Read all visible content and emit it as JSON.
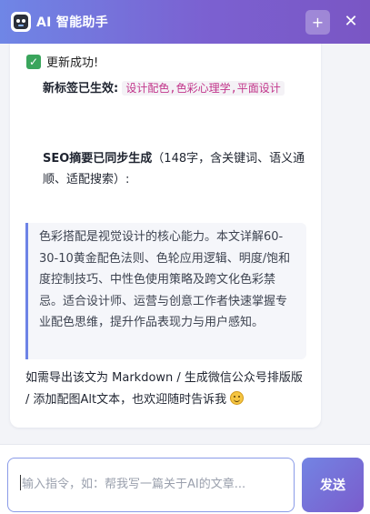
{
  "header": {
    "title": "AI 智能助手",
    "logo_icon": "robot-icon",
    "new_chat_label": "+",
    "close_label": "✕"
  },
  "message": {
    "success_icon": "check-icon",
    "success_text": "更新成功!",
    "tags_label": "新标签已生效:",
    "tags_value": "设计配色,色彩心理学,平面设计",
    "seo_label": "SEO摘要已同步生成",
    "seo_note": "（148字，含关键词、语义通顺、适配搜索）:",
    "seo_summary": "色彩搭配是视觉设计的核心能力。本文详解60-30-10黄金配色法则、色轮应用逻辑、明度/饱和度控制技巧、中性色使用策略及跨文化色彩禁忌。适合设计师、运营与创意工作者快速掌握专业配色思维，提升作品表现力与用户感知。",
    "followup": "如需导出该文为 Markdown / 生成微信公众号排版版 / 添加配图Alt文本，也欢迎随时告诉我",
    "emoji": "smile-icon"
  },
  "input": {
    "placeholder": "输入指令，如：帮我写一篇关于AI的文章...",
    "value": ""
  },
  "send_label": "发送",
  "colors": {
    "header_start": "#6f86e6",
    "header_end": "#7a56c4",
    "accent": "#6d83e6",
    "tag_text": "#c2368b",
    "success": "#3aa55c"
  }
}
